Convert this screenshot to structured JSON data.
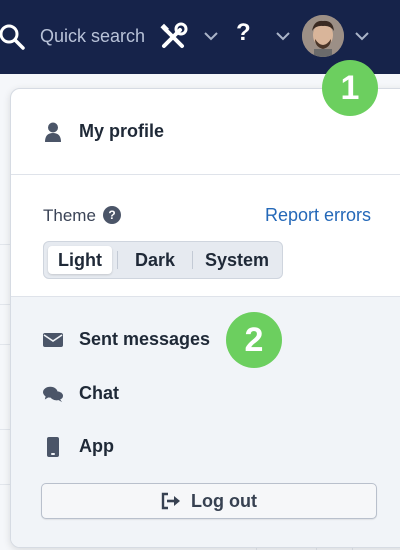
{
  "header": {
    "search_label": "Quick search",
    "help_label": "?",
    "colors": {
      "background": "#16234a",
      "icon": "#ffffff"
    }
  },
  "menu": {
    "profile_label": "My profile",
    "theme": {
      "label": "Theme",
      "options": [
        "Light",
        "Dark",
        "System"
      ],
      "selected": "Light"
    },
    "report_errors_label": "Report errors",
    "items": [
      {
        "label": "Sent messages",
        "icon": "envelope-icon"
      },
      {
        "label": "Chat",
        "icon": "chat-bubbles-icon"
      },
      {
        "label": "App",
        "icon": "mobile-phone-icon"
      }
    ],
    "logout_label": "Log out",
    "colors": {
      "link": "#2468b8"
    }
  },
  "annotations": {
    "badge_1": "1",
    "badge_2": "2",
    "color": "#6ccf5f"
  }
}
